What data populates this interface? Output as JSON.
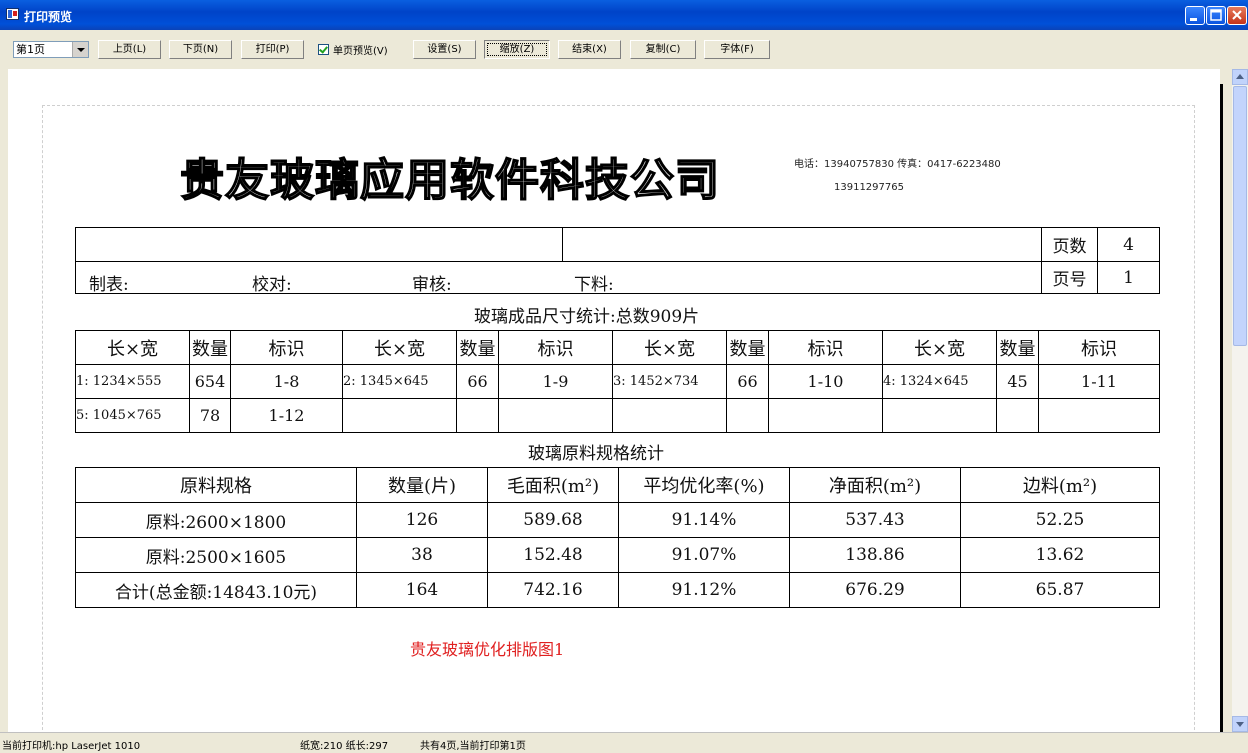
{
  "window": {
    "title": "打印预览"
  },
  "toolbar": {
    "page_select": "第1页",
    "prev": "上页(L)",
    "next": "下页(N)",
    "print": "打印(P)",
    "single_page_label": "单页预览(V)",
    "settings": "设置(S)",
    "zoom": "缩放(Z)",
    "end": "结束(X)",
    "copy": "复制(C)",
    "font": "字体(F)"
  },
  "document": {
    "company": "贵友玻璃应用软件科技公司",
    "phone_line": "电话：13940757830  传真：0417-6223480",
    "phone2": "13911297765",
    "header": {
      "page_count_label": "页数",
      "page_count": "4",
      "page_no_label": "页号",
      "page_no": "1",
      "maker": "制表:",
      "checker": "校对:",
      "reviewer": "审核:",
      "cutter": "下料:"
    },
    "section1_title": "玻璃成品尺寸统计:总数909片",
    "size_headers": [
      "长×宽",
      "数量",
      "标识",
      "长×宽",
      "数量",
      "标识",
      "长×宽",
      "数量",
      "标识",
      "长×宽",
      "数量",
      "标识"
    ],
    "size_rows": [
      [
        "1: 1234×555",
        "654",
        "1-8",
        "2: 1345×645",
        "66",
        "1-9",
        "3: 1452×734",
        "66",
        "1-10",
        "4: 1324×645",
        "45",
        "1-11"
      ],
      [
        "5: 1045×765",
        "78",
        "1-12",
        "",
        "",
        "",
        "",
        "",
        "",
        "",
        "",
        ""
      ]
    ],
    "section2_title": "玻璃原料规格统计",
    "material_headers": [
      "原料规格",
      "数量(片)",
      "毛面积(m²)",
      "平均优化率(%)",
      "净面积(m²)",
      "边料(m²)"
    ],
    "material_rows": [
      [
        "原料:2600×1800",
        "126",
        "589.68",
        "91.14%",
        "537.43",
        "52.25"
      ],
      [
        "原料:2500×1605",
        "38",
        "152.48",
        "91.07%",
        "138.86",
        "13.62"
      ],
      [
        "合计(总金额:14843.10元)",
        "164",
        "742.16",
        "91.12%",
        "676.29",
        "65.87"
      ]
    ],
    "caption": "贵友玻璃优化排版图1"
  },
  "status": {
    "printer": "当前打印机:hp LaserJet 1010",
    "paper": "纸宽:210 纸长:297",
    "pages": "共有4页,当前打印第1页"
  }
}
